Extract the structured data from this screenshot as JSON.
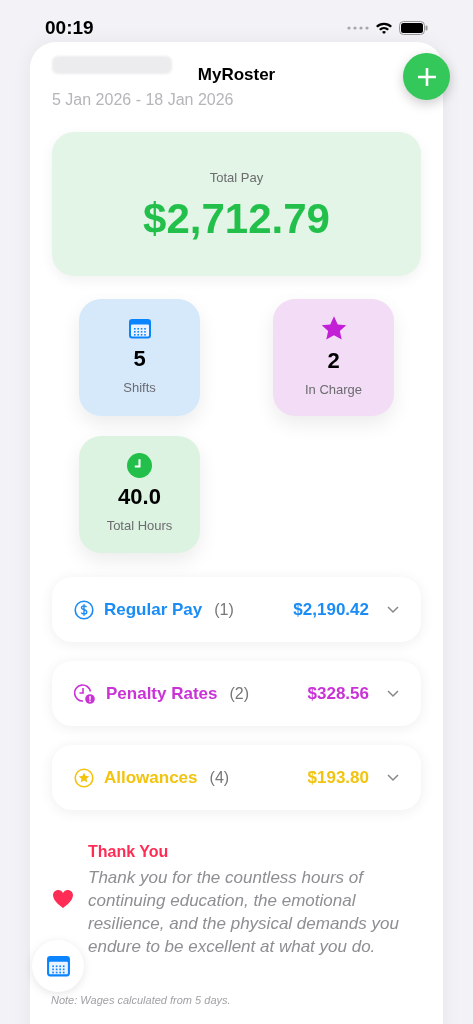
{
  "status_bar": {
    "time": "00:19"
  },
  "nav": {
    "title": "MyRoster"
  },
  "header": {
    "date_range": "5 Jan 2026 - 18 Jan 2026"
  },
  "total": {
    "label": "Total Pay",
    "amount": "$2,712.79"
  },
  "stats": [
    {
      "kind": "calendar",
      "value": "5",
      "label": "Shifts"
    },
    {
      "kind": "star",
      "value": "2",
      "label": "In Charge"
    },
    {
      "kind": "clock",
      "value": "40.0",
      "label": "Total Hours"
    }
  ],
  "pay_rows": [
    {
      "kind": "dollar",
      "label": "Regular Pay",
      "count": "(1)",
      "amount": "$2,190.42",
      "color": "#1a8cf5",
      "expanded": false
    },
    {
      "kind": "penalty",
      "label": "Penalty Rates",
      "count": "(2)",
      "amount": "$328.56",
      "color": "#c933d6",
      "expanded": false
    },
    {
      "kind": "allowance",
      "label": "Allowances",
      "count": "(4)",
      "amount": "$193.80",
      "color": "#f2c40f",
      "expanded": false
    }
  ],
  "thanks": {
    "title": "Thank You",
    "message": "Thank you for the countless hours of continuing education, the emotional resilience, and the physical demands you endure to be excellent at what you do."
  },
  "note": "Note: Wages calculated from 5 days."
}
